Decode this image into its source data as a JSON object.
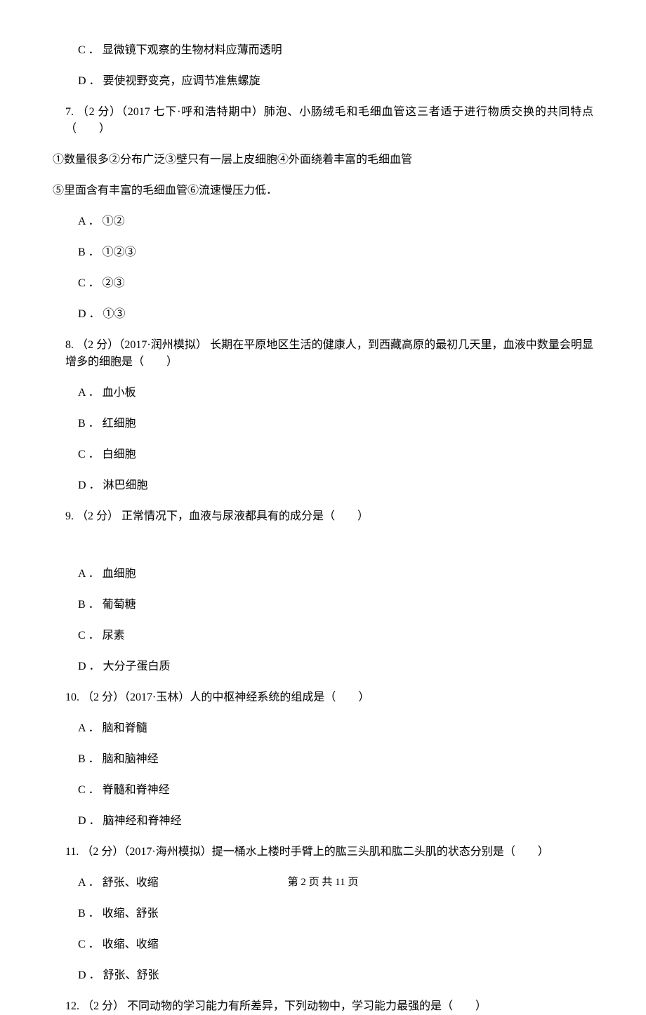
{
  "options_prev": {
    "c": "C ． 显微镜下观察的生物材料应薄而透明",
    "d": "D ． 要使视野变亮，应调节准焦螺旋"
  },
  "q7": {
    "stem": "7. （2 分）（2017 七下·呼和浩特期中）肺泡、小肠绒毛和毛细血管这三者适于进行物质交换的共同特点（　　）",
    "line2": "①数量很多②分布广泛③壁只有一层上皮细胞④外面绕着丰富的毛细血管",
    "line3": "⑤里面含有丰富的毛细血管⑥流速慢压力低．",
    "a": "A ． ①②",
    "b": "B ． ①②③",
    "c": "C ． ②③",
    "d": "D ． ①③"
  },
  "q8": {
    "stem": "8. （2 分）（2017·润州模拟） 长期在平原地区生活的健康人，到西藏高原的最初几天里，血液中数量会明显增多的细胞是（　　）",
    "a": "A ． 血小板",
    "b": "B ． 红细胞",
    "c": "C ． 白细胞",
    "d": "D ． 淋巴细胞"
  },
  "q9": {
    "stem": "9. （2 分） 正常情况下，血液与尿液都具有的成分是（　　）",
    "a": "A ． 血细胞",
    "b": "B ． 葡萄糖",
    "c": "C ． 尿素",
    "d": "D ． 大分子蛋白质"
  },
  "q10": {
    "stem": "10. （2 分）（2017·玉林）人的中枢神经系统的组成是（　　）",
    "a": "A ． 脑和脊髓",
    "b": "B ． 脑和脑神经",
    "c": "C ． 脊髓和脊神经",
    "d": "D ． 脑神经和脊神经"
  },
  "q11": {
    "stem": "11. （2 分）（2017·海州模拟）提一桶水上楼时手臂上的肱三头肌和肱二头肌的状态分别是（　　）",
    "a": "A ． 舒张、收缩",
    "b": "B ． 收缩、舒张",
    "c": "C ． 收缩、收缩",
    "d": "D ． 舒张、舒张"
  },
  "q12": {
    "stem": "12. （2 分） 不同动物的学习能力有所差异，下列动物中，学习能力最强的是（　　）"
  },
  "footer": "第 2 页 共 11 页"
}
